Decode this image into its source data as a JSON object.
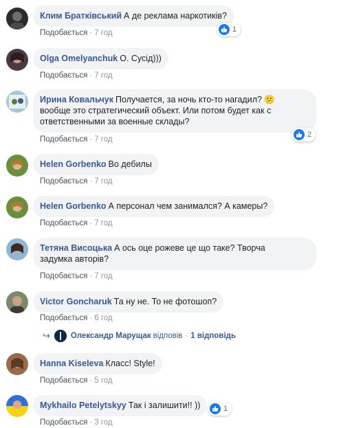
{
  "comments": [
    {
      "author": "Клим Братківський",
      "text": "А де реклама наркотиків?",
      "like_label": "Подобається",
      "time": "7 год",
      "reactions": "1"
    },
    {
      "author": "Olga Omelyanchuk",
      "text": "О. Сусід)))",
      "like_label": "Подобається",
      "time": "7 год"
    },
    {
      "author": "Ирина Ковальчук",
      "text_line1": "Получается, за ночь кто-то нагадил? 😕",
      "text_line2": "вообще это стратегический объект. Или потом будет как с",
      "text_line3": "ответственными за военные склады?",
      "like_label": "Подобається",
      "time": "7 год",
      "reactions": "2"
    },
    {
      "author": "Helen Gorbenko",
      "text": "Во дебилы",
      "like_label": "Подобається",
      "time": "7 год"
    },
    {
      "author": "Helen Gorbenko",
      "text": "А персонал чем занимался? А камеры?",
      "like_label": "Подобається",
      "time": "7 год"
    },
    {
      "author": "Тетяна Висоцька",
      "text_line1": "А ось оце рожеве це що таке? Творча",
      "text_line2": "задумка авторів?",
      "like_label": "Подобається",
      "time": "7 год"
    },
    {
      "author": "Victor Goncharuk",
      "text": "Та ну не. То не фотошоп?",
      "like_label": "Подобається",
      "time": "6 год"
    },
    {
      "author": "Hanna Kiseleva",
      "text": "Класс! Style!",
      "like_label": "Подобається",
      "time": "5 год"
    },
    {
      "author": "Mykhailo Petelytskyy",
      "text": "Так і залишити!! ))",
      "like_label": "Подобається",
      "time": "3 год",
      "reactions": "1"
    }
  ],
  "reply_summary": {
    "author": "Олександр Марущак",
    "verb": "відповів",
    "count": "1 відповідь"
  },
  "colors": {
    "bubble": "#f2f3f5",
    "author_link": "#385898",
    "like_blue": "#1877f2",
    "meta_text": "#90949c"
  },
  "icons": {
    "reaction": "like-icon",
    "reply": "reply-arrow-icon"
  }
}
